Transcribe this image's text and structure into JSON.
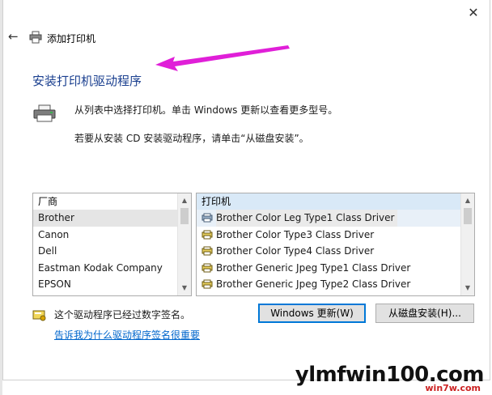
{
  "window": {
    "title": "添加打印机",
    "close_glyph": "✕",
    "back_glyph": "←"
  },
  "heading": "安装打印机驱动程序",
  "description": {
    "line1": "从列表中选择打印机。单击 Windows 更新以查看更多型号。",
    "line2": "若要从安装 CD 安装驱动程序，请单击“从磁盘安装”。"
  },
  "manufacturer_list": {
    "header": "厂商",
    "items": [
      "Brother",
      "Canon",
      "Dell",
      "Eastman Kodak Company",
      "EPSON"
    ],
    "selected_index": 0
  },
  "printer_list": {
    "header": "打印机",
    "items": [
      "Brother Color Leg Type1 Class Driver",
      "Brother Color Type3 Class Driver",
      "Brother Color Type4 Class Driver",
      "Brother Generic Jpeg Type1 Class Driver",
      "Brother Generic Jpeg Type2 Class Driver"
    ],
    "selected_index": 0
  },
  "signature": {
    "text": "这个驱动程序已经过数字签名。",
    "link": "告诉我为什么驱动程序签名很重要"
  },
  "buttons": {
    "windows_update": "Windows 更新(W)",
    "from_disk": "从磁盘安装(H)..."
  },
  "watermark": {
    "main": "ylmfwin100.com",
    "sub": "win7w.com"
  },
  "colors": {
    "heading": "#1a3f8f",
    "arrow": "#e01fd8",
    "link": "#0066cc",
    "focus_border": "#0078d7"
  },
  "icons": [
    "back-arrow-icon",
    "printer-icon",
    "printer-large-icon",
    "driver-icon",
    "signed-driver-icon",
    "close-icon"
  ]
}
